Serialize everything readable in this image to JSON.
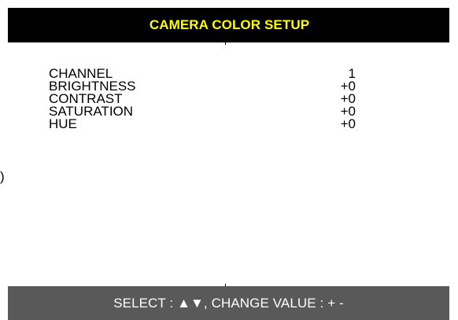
{
  "header": {
    "title": "CAMERA COLOR SETUP",
    "title_color": "#ffff00",
    "background": "#000000"
  },
  "settings": [
    {
      "label": "CHANNEL",
      "value": "1"
    },
    {
      "label": "BRIGHTNESS",
      "value": "+0"
    },
    {
      "label": "CONTRAST",
      "value": "+0"
    },
    {
      "label": "SATURATION",
      "value": "+0"
    },
    {
      "label": "HUE",
      "value": "+0"
    }
  ],
  "edge_glyph": ")",
  "footer": {
    "hint": "SELECT : ▲▼, CHANGE VALUE : + -",
    "background": "#595959",
    "text_color": "#ffffff"
  }
}
